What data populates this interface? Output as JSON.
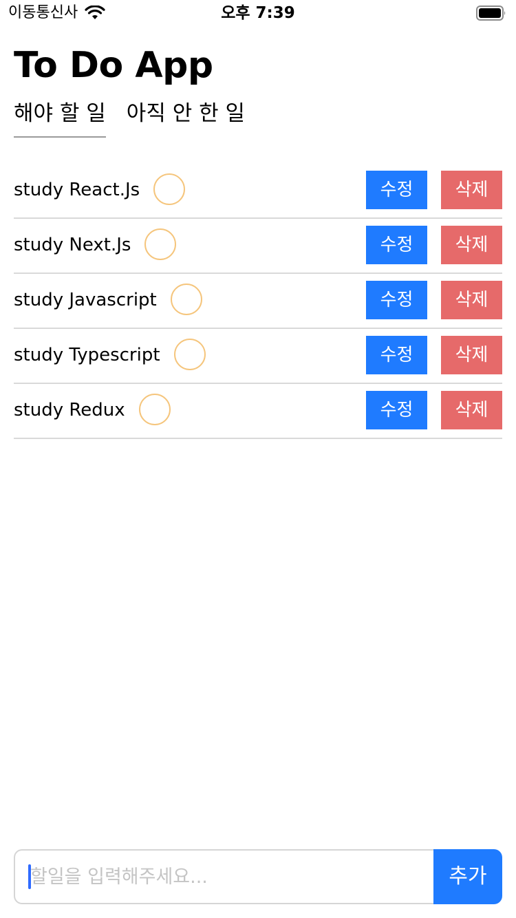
{
  "status_bar": {
    "carrier": "이동통신사",
    "time": "오후 7:39"
  },
  "header": {
    "title": "To Do App"
  },
  "tabs": [
    {
      "label": "해야 할 일",
      "active": true
    },
    {
      "label": "아직 안 한 일",
      "active": false
    }
  ],
  "todos": [
    {
      "text": "study React.Js",
      "edit_label": "수정",
      "delete_label": "삭제"
    },
    {
      "text": "study Next.Js",
      "edit_label": "수정",
      "delete_label": "삭제"
    },
    {
      "text": "study Javascript",
      "edit_label": "수정",
      "delete_label": "삭제"
    },
    {
      "text": "study Typescript",
      "edit_label": "수정",
      "delete_label": "삭제"
    },
    {
      "text": "study Redux",
      "edit_label": "수정",
      "delete_label": "삭제"
    }
  ],
  "input_bar": {
    "value": "",
    "placeholder": "할일을 입력해주세요...",
    "add_label": "추가"
  },
  "icons": {
    "wifi": "wifi-icon",
    "battery": "battery-icon",
    "check": "circle-checkbox-icon"
  },
  "colors": {
    "edit_button": "#1f7bff",
    "delete_button": "#e66a6a",
    "check_circle": "#f5c57c",
    "add_button": "#1f7bff"
  }
}
